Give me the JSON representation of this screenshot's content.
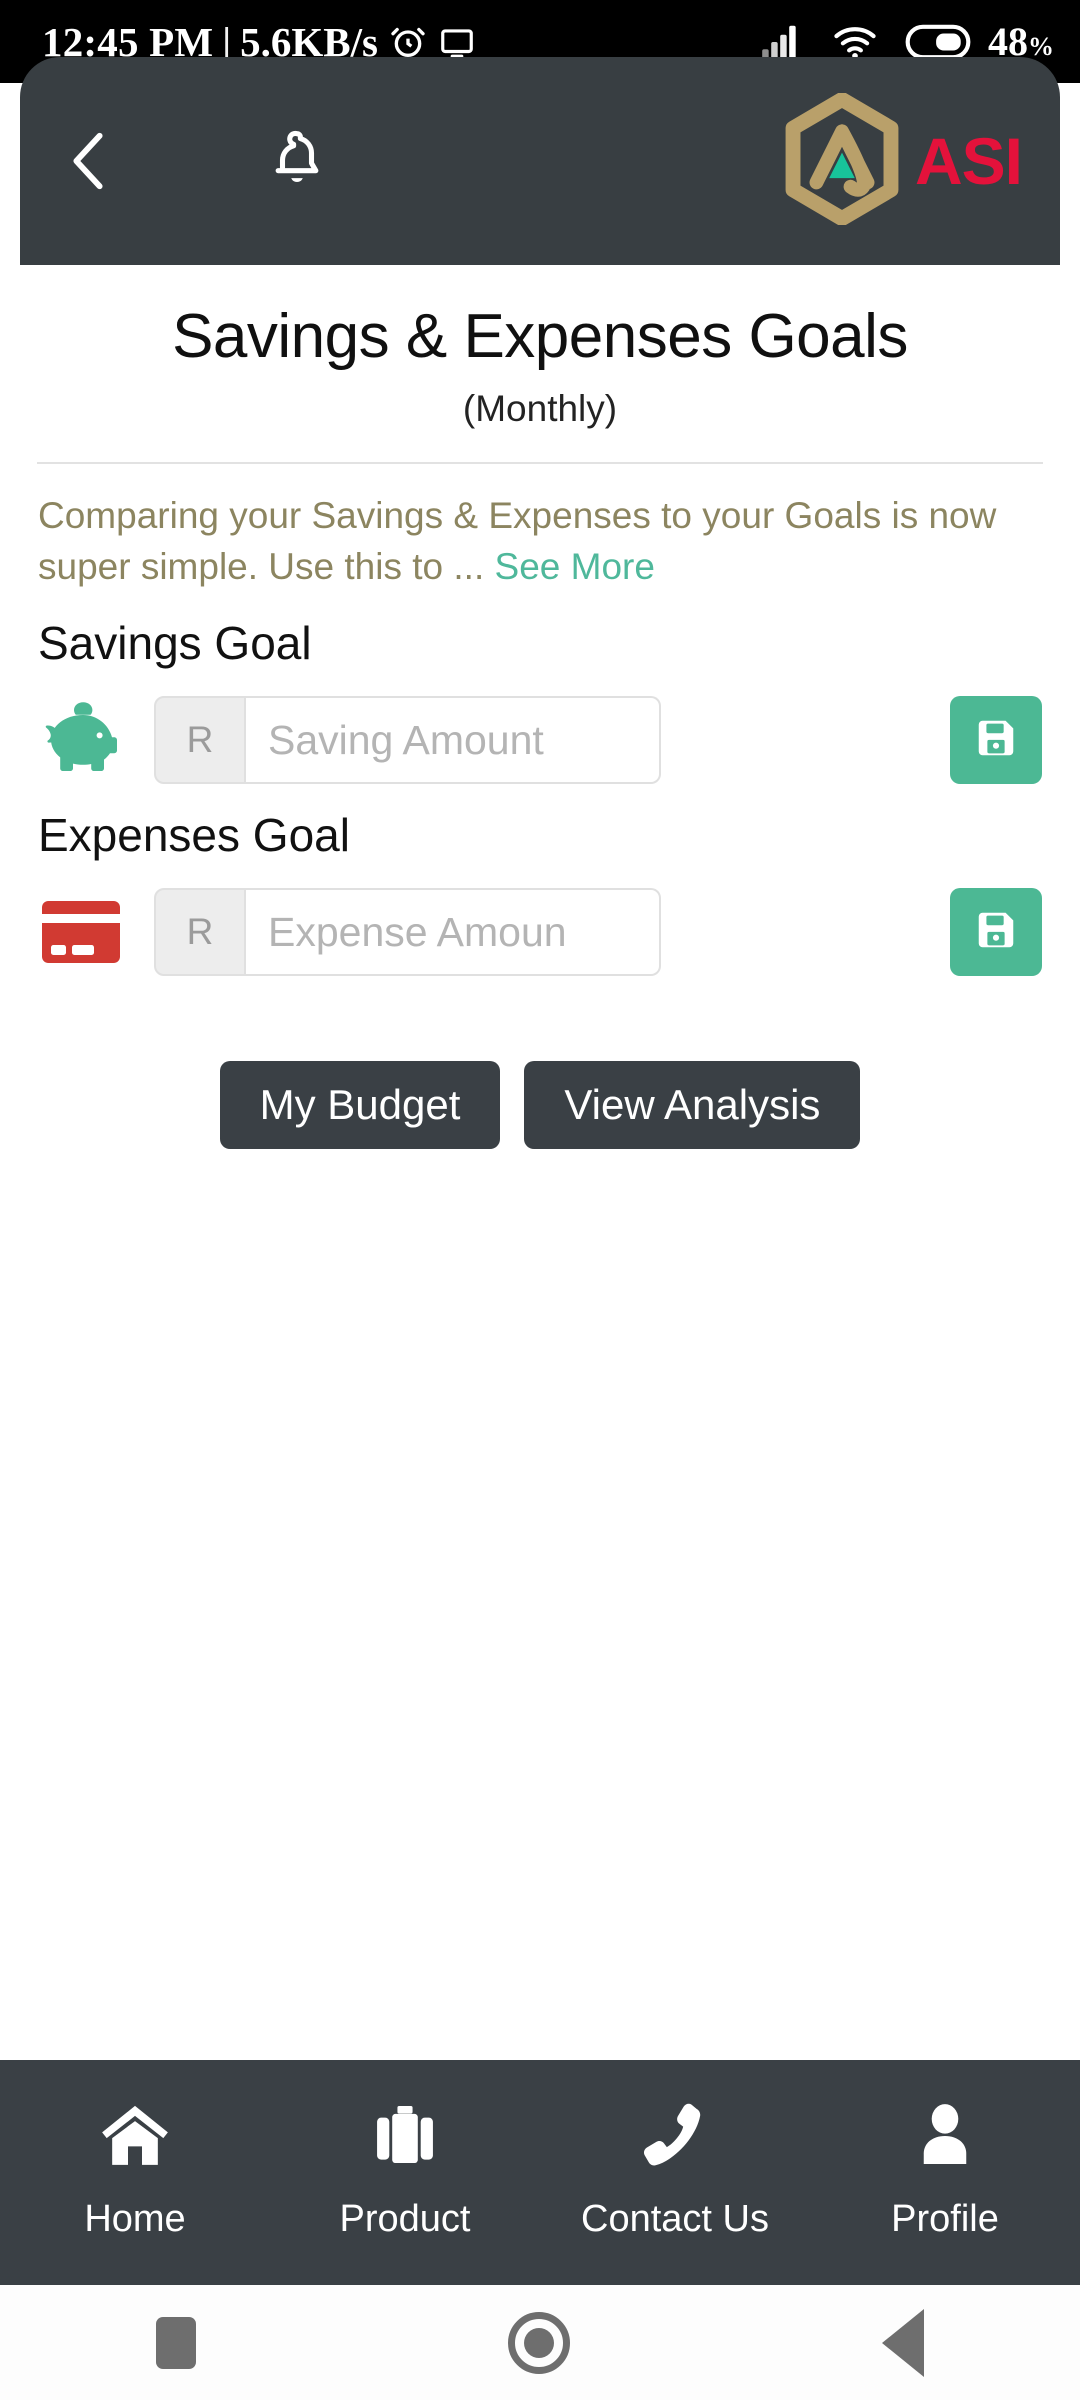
{
  "status_bar": {
    "time": "12:45 PM",
    "separator": "|",
    "network_speed": "5.6KB/s",
    "alarm_icon": "alarm-icon",
    "cast_icon": "cast-icon",
    "signal_icon": "signal-bars-icon",
    "wifi_icon": "wifi-icon",
    "battery_icon": "battery-icon",
    "battery_percent": "48",
    "battery_percent_symbol": "%"
  },
  "app_bar": {
    "back_icon": "back-chevron-icon",
    "menu_icon": "hamburger-menu-icon",
    "notification_icon": "bell-icon",
    "logo_icon": "asi-hexagon-logo-icon",
    "brand_text": "ASI",
    "background_color": "#383E42",
    "brand_color": "#E4123B",
    "logo_gold": "#B9A06A",
    "logo_teal": "#18C39A"
  },
  "page": {
    "title": "Savings & Expenses Goals",
    "subtitle": "(Monthly)",
    "description": "Comparing your Savings & Expenses to your Goals is now super simple. Use this to ...",
    "see_more_label": "See More",
    "description_color": "#8C8560",
    "see_more_color": "#4FB89B"
  },
  "savings": {
    "section_label": "Savings Goal",
    "icon": "piggy-bank-icon",
    "icon_color": "#4CB894",
    "currency_prefix": "R",
    "input_value": "",
    "input_placeholder": "Saving Amount",
    "save_icon": "floppy-disk-save-icon",
    "save_button_color": "#4CB894"
  },
  "expenses": {
    "section_label": "Expenses Goal",
    "icon": "credit-card-icon",
    "icon_color": "#D13A32",
    "currency_prefix": "R",
    "input_value": "",
    "input_placeholder": "Expense Amoun",
    "save_icon": "floppy-disk-save-icon",
    "save_button_color": "#4CB894"
  },
  "actions": {
    "my_budget_label": "My Budget",
    "view_analysis_label": "View Analysis",
    "button_color": "#3A4045"
  },
  "tab_bar": {
    "background_color": "#3A4045",
    "items": [
      {
        "label": "Home",
        "icon": "home-icon"
      },
      {
        "label": "Product",
        "icon": "briefcase-icon"
      },
      {
        "label": "Contact Us",
        "icon": "phone-icon"
      },
      {
        "label": "Profile",
        "icon": "person-icon"
      }
    ]
  },
  "nav_bar": {
    "recents_icon": "recents-square-icon",
    "home_icon": "home-circle-icon",
    "back_icon": "back-triangle-icon"
  }
}
